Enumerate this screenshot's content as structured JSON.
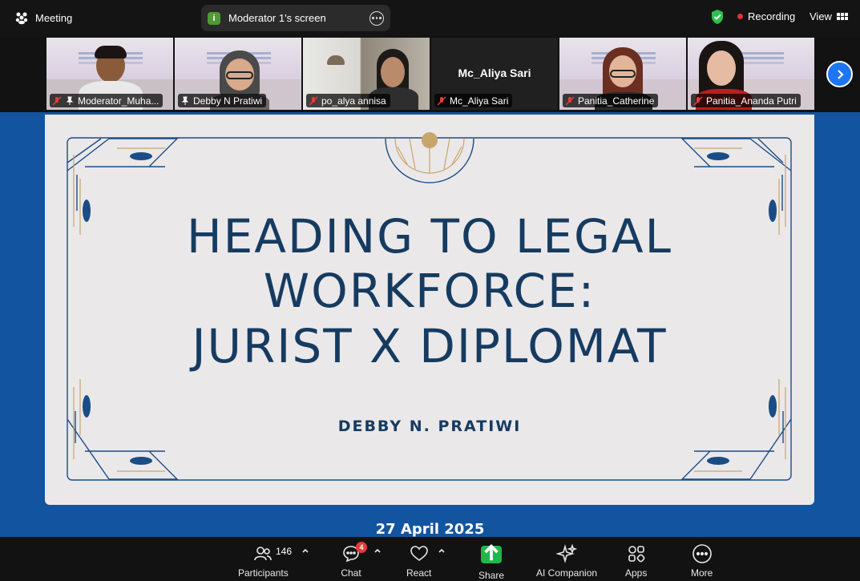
{
  "topbar": {
    "meeting_label": "Meeting",
    "screen_chip_label": "Moderator 1's screen",
    "screen_chip_badge": "i",
    "recording_label": "Recording",
    "view_label": "View"
  },
  "participants": [
    {
      "name": "Moderator_Muha...",
      "muted": true
    },
    {
      "name": "Debby N Pratiwi",
      "muted": false,
      "active": true
    },
    {
      "name": "po_alya annisa",
      "muted": true
    },
    {
      "name": "Mc_Aliya Sari",
      "muted": true,
      "video_off": true
    },
    {
      "name": "Panitia_Catherine",
      "muted": true
    },
    {
      "name": "Panitia_Ananda Putri",
      "muted": true
    }
  ],
  "slide": {
    "title_line1": "HEADING TO LEGAL",
    "title_line2": "WORKFORCE:",
    "title_line3": "JURIST X DIPLOMAT",
    "presenter": "DEBBY N. PRATIWI",
    "date": "27 April 2025"
  },
  "toolbar": {
    "participants_label": "Participants",
    "participants_count": "146",
    "chat_label": "Chat",
    "chat_badge": "4",
    "react_label": "React",
    "share_label": "Share",
    "ai_label": "AI Companion",
    "apps_label": "Apps",
    "more_label": "More"
  },
  "colors": {
    "accent_blue": "#1354a0",
    "slide_text": "#163b60",
    "share_green": "#20b74a",
    "active_speaker": "#35d66f",
    "recording_red": "#e8303a"
  }
}
